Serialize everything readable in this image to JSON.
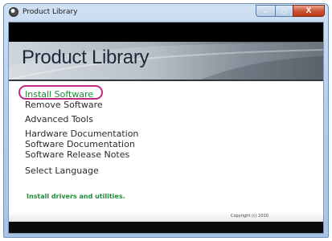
{
  "window": {
    "title": "Product Library",
    "controls": {
      "minimize": "–",
      "maximize": "□",
      "close": "X"
    }
  },
  "banner": {
    "title": "Product Library"
  },
  "menu": {
    "items": [
      {
        "label": "Install Software",
        "active": true
      },
      {
        "label": "Remove Software"
      },
      {
        "label": "Advanced Tools"
      },
      {
        "label": "Hardware Documentation"
      },
      {
        "label": "Software Documentation"
      },
      {
        "label": "Software Release Notes"
      },
      {
        "label": "Select Language"
      }
    ]
  },
  "status": {
    "text": "Install drivers and utilities."
  },
  "footer": {
    "copyright": "Copyright (c) 2010"
  },
  "colors": {
    "active": "#1e8c3a",
    "highlight": "#c0287e",
    "bar": "#000000"
  },
  "icons": {
    "app": "product-library-app-icon"
  }
}
